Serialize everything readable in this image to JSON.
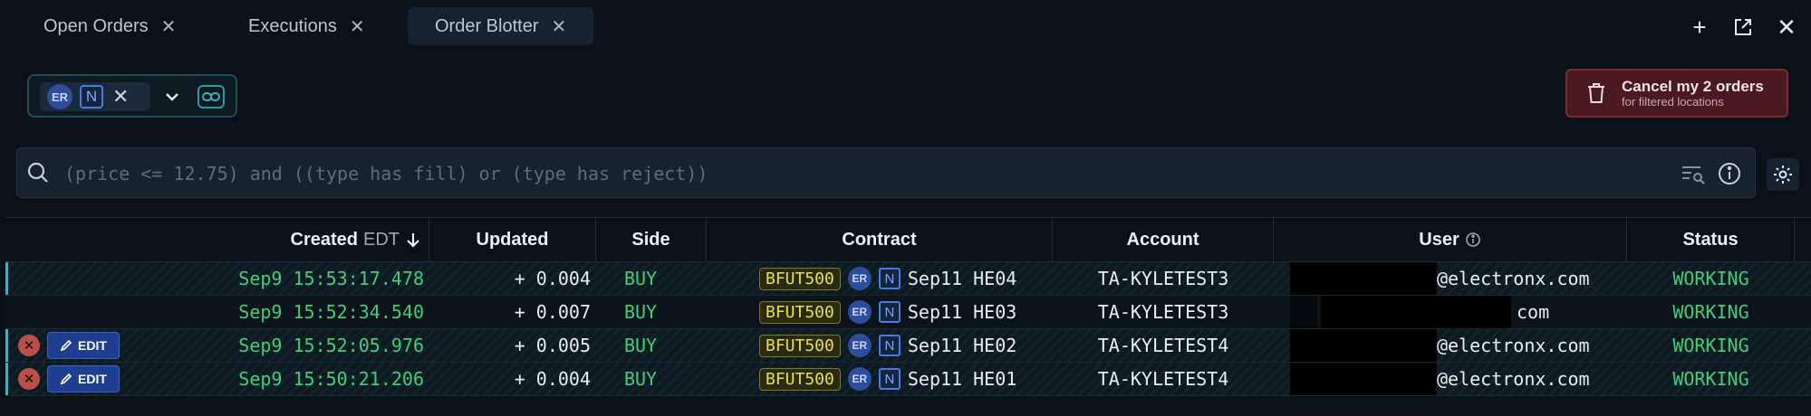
{
  "tabs": [
    {
      "label": "Open Orders"
    },
    {
      "label": "Executions"
    },
    {
      "label": "Order Blotter"
    }
  ],
  "filter": {
    "chip_er": "ER",
    "chip_n": "N"
  },
  "cancel_button": {
    "title": "Cancel my 2 orders",
    "subtitle": "for filtered locations"
  },
  "search": {
    "placeholder": "(price <= 12.75) and ((type has fill) or (type has reject))"
  },
  "table": {
    "headers": {
      "created": "Created",
      "created_tz": "EDT",
      "updated": "Updated",
      "side": "Side",
      "contract": "Contract",
      "account": "Account",
      "user": "User",
      "status": "Status"
    },
    "edit_label": "EDIT",
    "rows": [
      {
        "created": "Sep9 15:53:17.478",
        "updated": "+ 0.004",
        "side": "BUY",
        "product": "BFUT500",
        "venue_er": "ER",
        "venue_n": "N",
        "contract": "Sep11 HE04",
        "account": "TA-KYLETEST3",
        "user": "@electronx.com",
        "status": "WORKING"
      },
      {
        "created": "Sep9 15:52:34.540",
        "updated": "+ 0.007",
        "side": "BUY",
        "product": "BFUT500",
        "venue_er": "ER",
        "venue_n": "N",
        "contract": "Sep11 HE03",
        "account": "TA-KYLETEST3",
        "user": "com",
        "status": "WORKING"
      },
      {
        "created": "Sep9 15:52:05.976",
        "updated": "+ 0.005",
        "side": "BUY",
        "product": "BFUT500",
        "venue_er": "ER",
        "venue_n": "N",
        "contract": "Sep11 HE02",
        "account": "TA-KYLETEST4",
        "user": "@electronx.com",
        "status": "WORKING"
      },
      {
        "created": "Sep9 15:50:21.206",
        "updated": "+ 0.004",
        "side": "BUY",
        "product": "BFUT500",
        "venue_er": "ER",
        "venue_n": "N",
        "contract": "Sep11 HE01",
        "account": "TA-KYLETEST4",
        "user": "@electronx.com",
        "status": "WORKING"
      }
    ]
  }
}
